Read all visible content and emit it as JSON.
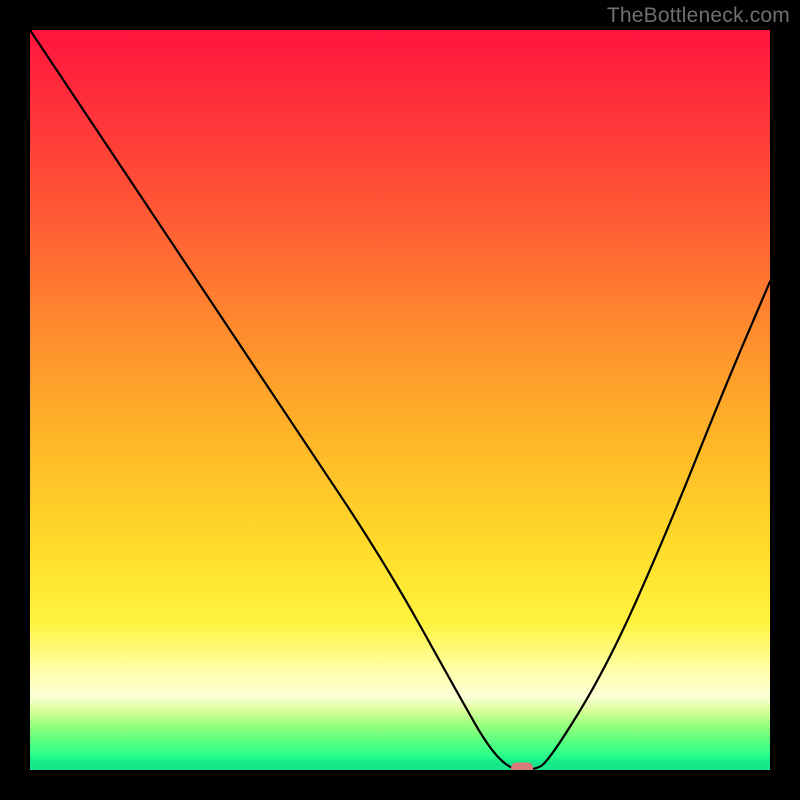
{
  "watermark": "TheBottleneck.com",
  "chart_data": {
    "type": "line",
    "title": "",
    "xlabel": "",
    "ylabel": "",
    "xlim": [
      0,
      100
    ],
    "ylim": [
      0,
      100
    ],
    "grid": false,
    "background_gradient": {
      "top_color": "#ff153e",
      "bottom_color": "#18e58c",
      "description": "red (high bottleneck) → yellow → green (no bottleneck)"
    },
    "series": [
      {
        "name": "bottleneck-curve",
        "x": [
          0,
          12,
          24,
          36,
          48,
          58,
          62,
          65,
          68,
          70,
          78,
          86,
          94,
          100
        ],
        "values": [
          100,
          82,
          64,
          46,
          28,
          10,
          3,
          0,
          0,
          1,
          14,
          32,
          52,
          66
        ]
      }
    ],
    "marker": {
      "x": 66.5,
      "y": 0,
      "color": "#d87b79",
      "shape": "rounded-rect"
    }
  }
}
